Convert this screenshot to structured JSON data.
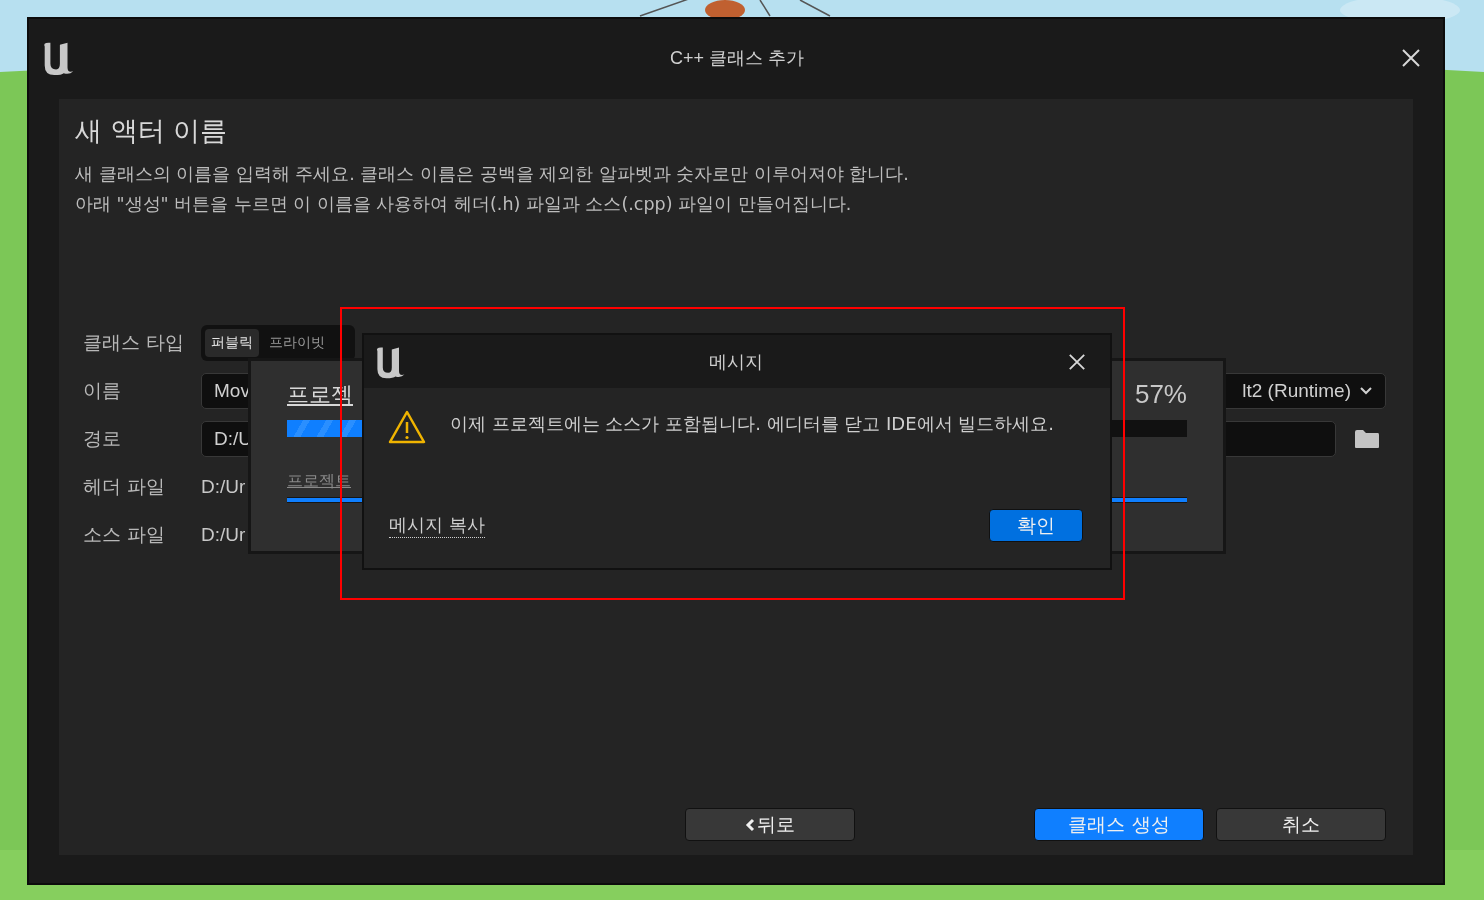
{
  "window": {
    "title": "C++ 클래스 추가"
  },
  "heading": "새 액터 이름",
  "description": [
    "새 클래스의 이름을 입력해 주세요. 클래스 이름은 공백을 제외한 알파벳과 숫자로만 이루어져야 합니다.",
    "아래 \"생성\" 버튼을 누르면 이 이름을 사용하여 헤더(.h) 파일과 소스(.cpp) 파일이 만들어집니다."
  ],
  "form": {
    "class_type": {
      "label": "클래스 타입",
      "tabs": [
        {
          "label": "퍼블릭",
          "selected": true
        },
        {
          "label": "프라이빗",
          "selected": false
        }
      ]
    },
    "name": {
      "label": "이름",
      "value": "Mov",
      "module": "lt2 (Runtime)"
    },
    "path": {
      "label": "경로",
      "value": "D:/U"
    },
    "header_file": {
      "label": "헤더 파일",
      "value": "D:/Ur"
    },
    "source_file": {
      "label": "소스 파일",
      "value": "D:/Ur"
    }
  },
  "buttons": {
    "back": "뒤로",
    "create": "클래스 생성",
    "cancel": "취소"
  },
  "progress": {
    "title": "프로젝",
    "percent": "57%",
    "level": 0.57,
    "sub_progress": {
      "label": "프로젝트",
      "level": 1
    }
  },
  "message": {
    "title": "메시지",
    "text": "이제 프로젝트에는 소스가 포함됩니다. 에디터를 닫고 IDE에서 빌드하세요.",
    "copy_link": "메시지 복사",
    "ok": "확인"
  }
}
